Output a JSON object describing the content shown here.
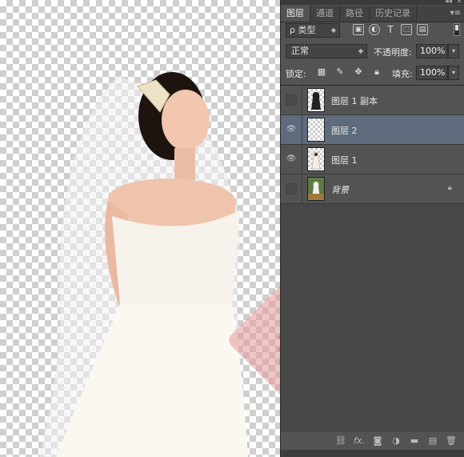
{
  "panel": {
    "tabs": [
      {
        "label": "图层",
        "active": true
      },
      {
        "label": "通道",
        "active": false
      },
      {
        "label": "路径",
        "active": false
      },
      {
        "label": "历史记录",
        "active": false
      }
    ],
    "filter_kind": "ρ 类型",
    "blend_mode": "正常",
    "opacity_label": "不透明度:",
    "opacity_value": "100%",
    "lock_label": "锁定:",
    "fill_label": "填充:",
    "fill_value": "100%",
    "layers": [
      {
        "name": "图层 1 副本",
        "visible": false,
        "selected": false,
        "italic": false,
        "locked": false
      },
      {
        "name": "图层 2",
        "visible": true,
        "selected": true,
        "italic": false,
        "locked": false
      },
      {
        "name": "图层 1",
        "visible": true,
        "selected": false,
        "italic": false,
        "locked": false
      },
      {
        "name": "背景",
        "visible": false,
        "selected": false,
        "italic": true,
        "locked": true
      }
    ],
    "bottom_icons": [
      "link-icon",
      "fx-icon",
      "mask-icon",
      "adjustment-icon",
      "folder-icon",
      "new-layer-icon",
      "trash-icon"
    ],
    "fx_label": "fx."
  },
  "colors": {
    "panel_bg": "#535353",
    "selected_layer": "#5d6b7c",
    "tab_bar": "#424242"
  }
}
